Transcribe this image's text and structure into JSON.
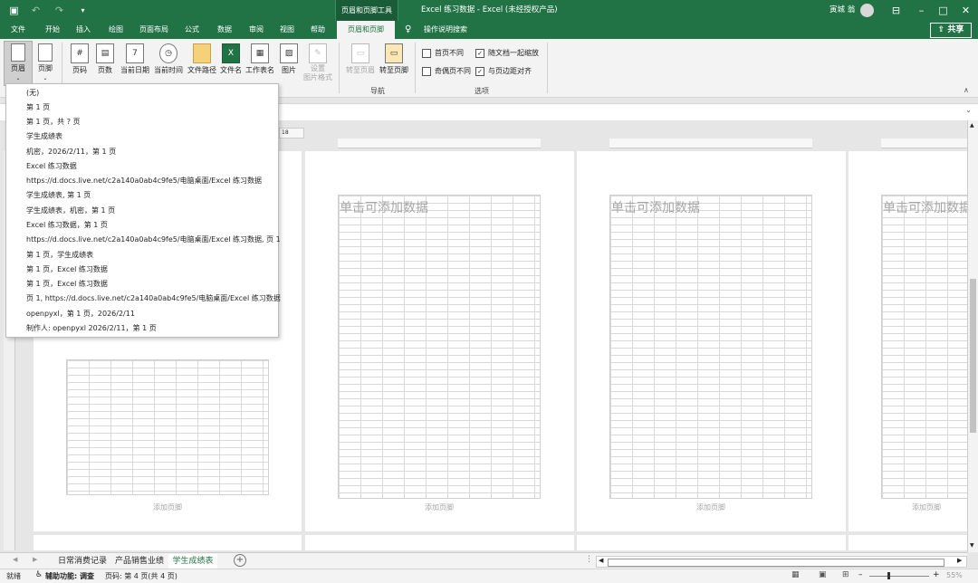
{
  "titlebar": {
    "contextual_tab": "页眉和页脚工具",
    "title": "Excel 练习数据  -  Excel (未经授权产品)",
    "user": "寅城 翁",
    "share_label": "共享"
  },
  "tabs": [
    "文件",
    "开始",
    "插入",
    "绘图",
    "页面布局",
    "公式",
    "数据",
    "审阅",
    "视图",
    "帮助",
    "页眉和页脚",
    "操作说明搜索"
  ],
  "ribbon": {
    "header_btn": "页眉",
    "footer_btn": "页脚",
    "elements": [
      "页码",
      "页数",
      "当前日期",
      "当前时间",
      "文件路径",
      "文件名",
      "工作表名",
      "图片",
      "设置\n图片格式"
    ],
    "nav": [
      "转至页眉",
      "转至页脚"
    ],
    "nav_group": "导航",
    "options": [
      "首页不同",
      "奇偶页不同",
      "随文档一起缩放",
      "与页边距对齐"
    ],
    "options_checked": [
      false,
      false,
      true,
      true
    ],
    "options_group": "选项"
  },
  "dropdown": [
    "(无)",
    "第 1 页",
    "第 1 页，共 ? 页",
    "学生成绩表",
    " 机密，2026/2/11，第 1 页",
    "Excel 练习数据",
    "https://d.docs.live.net/c2a140a0ab4c9fe5/电脑桌面/Excel 练习数据",
    "学生成绩表, 第 1 页",
    "学生成绩表，机密，第 1 页",
    "Excel 练习数据，第 1 页",
    "https://d.docs.live.net/c2a140a0ab4c9fe5/电脑桌面/Excel 练习数据, 页 1",
    "第 1 页，学生成绩表",
    "第 1 页，Excel 练习数据",
    "第 1 页，Excel 练习数据",
    "页 1, https://d.docs.live.net/c2a140a0ab4c9fe5/电脑桌面/Excel 练习数据",
    "openpyxl，第 1 页，2026/2/11",
    "制作人: openpyxl 2026/2/11，第 1 页"
  ],
  "pages": {
    "header_placeholder": "单击可添加数据",
    "footer_placeholder": "添加页脚",
    "row_18": "18"
  },
  "sheets": [
    "日常消费记录",
    "产品销售业绩",
    "学生成绩表"
  ],
  "active_sheet": 2,
  "status": {
    "ready": "就绪",
    "accessibility": "辅助功能: 调查",
    "page_info": "页码: 第 4 页(共 4 页)",
    "zoom": "55%"
  },
  "colors": {
    "accent": "#217346"
  }
}
